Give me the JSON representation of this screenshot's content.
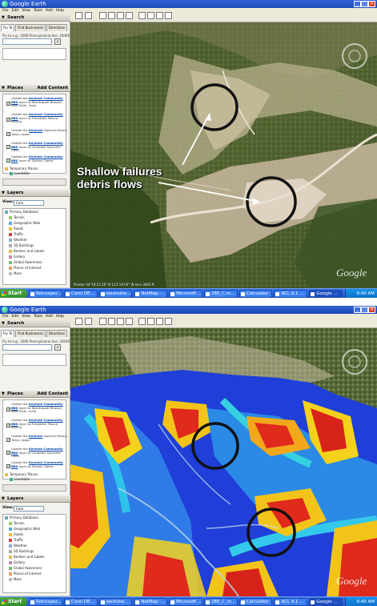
{
  "app": {
    "title": "Google Earth",
    "menu": [
      "File",
      "Edit",
      "View",
      "Tools",
      "Add",
      "Help"
    ]
  },
  "left_panel": {
    "search_header": "Search",
    "tabs": [
      "Fly To",
      "Find Businesses",
      "Directions"
    ],
    "fly_to_hint": "Fly to e.g., 1600 Pennsylvania Ave, 20006",
    "places_header": "Places",
    "places_add": "Add Content",
    "places_items": [
      {
        "prefix": "Unable the",
        "link": "Keyhole Community BBS",
        "suffix": "layer to Rashtrapati Bhavan, New Delhi, India"
      },
      {
        "prefix": "Unable the",
        "link": "Keyhole Community BBS",
        "suffix": "layer to Forbidden Palace, Beijing"
      },
      {
        "prefix": "Unable the",
        "link": "Keyhole",
        "suffix": "Imperial Palace, Tokyo, Japan"
      },
      {
        "prefix": "Unable the",
        "link": "Keyhole Community BBS",
        "suffix": "layer to Canadian Supreme Court"
      },
      {
        "prefix": "Unable the",
        "link": "Keyhole Community BBS",
        "suffix": "layer to Sydney Opera"
      }
    ],
    "temporary_places": "Temporary Places",
    "landslide_item": "Landslide",
    "layers_header": "Layers",
    "view_label": "View:",
    "view_value": "Core",
    "layers": [
      "Primary Database",
      "Terrain",
      "Geographic Web",
      "Roads",
      "Traffic",
      "Weather",
      "3D Buildings",
      "Borders and Labels",
      "Gallery",
      "Global Awareness",
      "Places of Interest",
      "More"
    ]
  },
  "annotation": {
    "line1": "Shallow failures",
    "line2": "debris flows"
  },
  "statusbar": {
    "text": "Pointer 44°18'23.28\" N 122°24'00\" W  elev 3083 ft"
  },
  "logo": "Google",
  "taskbar": {
    "start": "Start",
    "tasks_top": [
      "Retrospec...",
      "Corel DE...",
      "westsshe...",
      "NetMap -...",
      "Microsoft ...",
      "280_C.m...",
      "Calculator",
      "ACL 9.1 ...",
      "Google ..."
    ],
    "tasks_bottom": [
      "Retrospec...",
      "Corel DE...",
      "westshe...",
      "NetMap -...",
      "Microsoft ...",
      "280_C_m...",
      "Calculator",
      "ACL 9.1 ...",
      "Google ..."
    ],
    "clock_top": "9:40 AM",
    "clock_bottom": "9:40 AM"
  },
  "colors": {
    "xp_blue": "#2457c5",
    "start_green": "#2f8a2c",
    "circle_stroke": "#111111",
    "hazard_high": "#e02a1c",
    "hazard_low": "#1f3fd8"
  }
}
